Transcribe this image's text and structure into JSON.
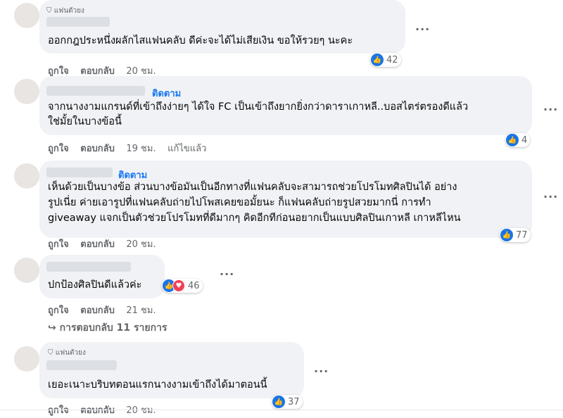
{
  "comments": [
    {
      "badge": "แฟนตัวยง",
      "text_lines": [
        "ออกกฎประหนึ่งผลักไสแฟนคลับ ดีค่ะจะได้ไม่เสียเงิน ขอให้รวยๆ นะคะ"
      ],
      "like_label": "ถูกใจ",
      "reply_label": "ตอบกลับ",
      "time": "20 ชม.",
      "reaction_count": "42"
    },
    {
      "follow_label": "ติดตาม",
      "text_lines": [
        "จากนางงามแกรนด์ที่เข้าถึงง่ายๆ ได้ใจ FC เป็นเข้าถึงยากยิ่งกว่าดาราเกาหลี..บอสไตร่ตรองดีแล้ว",
        "ใช่มั้ยในบางข้อนี้"
      ],
      "like_label": "ถูกใจ",
      "reply_label": "ตอบกลับ",
      "time": "19 ชม.",
      "edited": "แก้ไขแล้ว",
      "reaction_count": "4"
    },
    {
      "follow_label": "ติดตาม",
      "text_lines": [
        "เห็นด้วยเป็นบางข้อ ส่วนบางข้อมันเป็นอีกทางที่แฟนคลับจะสามารถช่วยโปรโมทศิลปินได้ อย่าง",
        "รูปเนี่ย ค่ายเอารูปที่แฟนคลับถ่ายไปโพสเคยขอมั้ยนะ ก็แฟนคลับถ่ายรูปสวยมากนี่ การทำ",
        "giveaway แจกเป็นตัวช่วยโปรโมทที่ดีมากๆ คิดอีกทีก่อนอยากเป็นแบบศิลปินเกาหลี เกาหลีไหน"
      ],
      "like_label": "ถูกใจ",
      "reply_label": "ตอบกลับ",
      "time": "20 ชม.",
      "reaction_count": "77"
    },
    {
      "text_lines": [
        "ปกป้องศิลปินดีแล้วค่ะ"
      ],
      "like_label": "ถูกใจ",
      "reply_label": "ตอบกลับ",
      "time": "21 ชม.",
      "reaction_count": "46",
      "replies_label": "↪ การตอบกลับ 11 รายการ"
    },
    {
      "badge": "แฟนตัวยง",
      "text_lines": [
        "เยอะเนาะบริบทตอนแรกนางงามเข้าถึงได้มาตอนนี้"
      ],
      "like_label": "ถูกใจ",
      "reply_label": "ตอบกลับ",
      "time": "20 ชม.",
      "reaction_count": "37"
    }
  ],
  "icons": {
    "more": "more-options-icon",
    "like": "like-reaction-icon",
    "love": "love-reaction-icon",
    "badge": "top-fan-badge-icon"
  },
  "colors": {
    "accent": "#1877f2",
    "bubble": "#f0f2f5",
    "secondary_text": "#65676b",
    "like": "#1b74e4",
    "love": "#f33e58"
  }
}
